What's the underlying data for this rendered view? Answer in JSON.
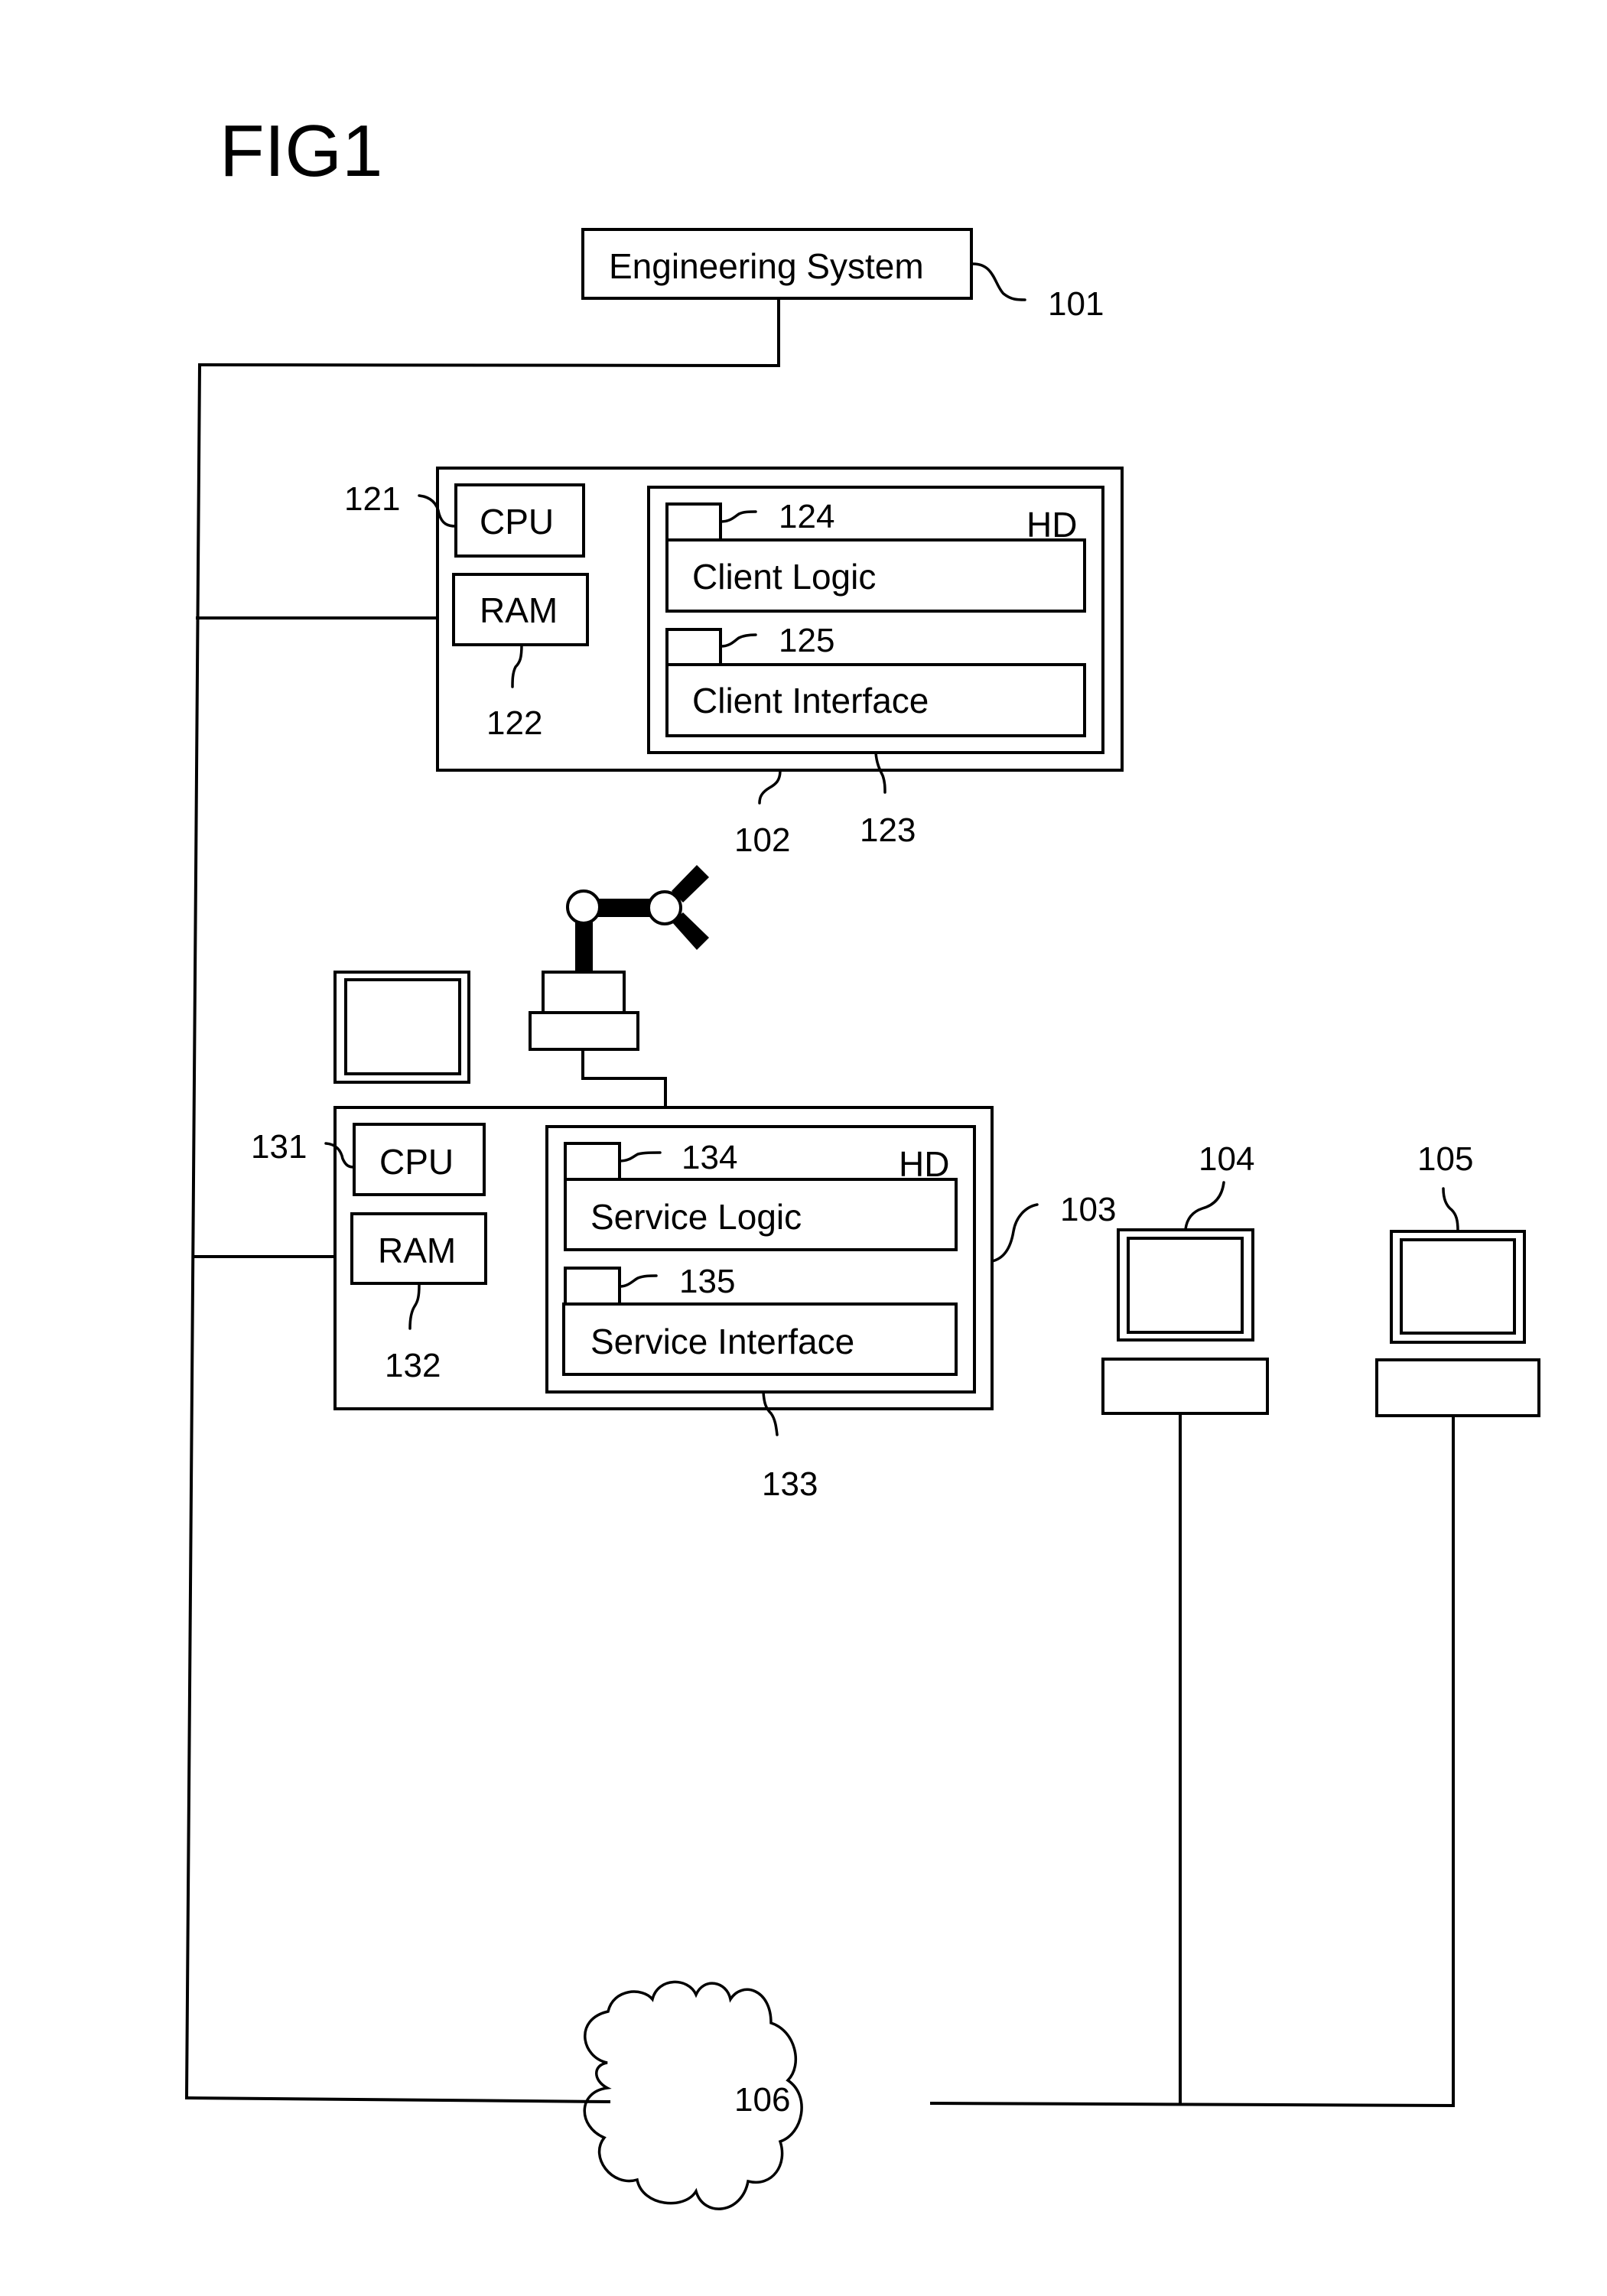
{
  "figure": {
    "title": "FIG1"
  },
  "engineering_system": {
    "label": "Engineering System",
    "ref": "101"
  },
  "client_computer": {
    "ref": "102",
    "cpu": {
      "label": "CPU",
      "ref": "121"
    },
    "ram": {
      "label": "RAM",
      "ref": "122"
    },
    "hard_disk": {
      "label": "HD",
      "ref": "123",
      "modules": [
        {
          "label": "Client Logic",
          "ref": "124"
        },
        {
          "label": "Client Interface",
          "ref": "125"
        }
      ]
    }
  },
  "service_computer": {
    "ref": "103",
    "cpu": {
      "label": "CPU",
      "ref": "131"
    },
    "ram": {
      "label": "RAM",
      "ref": "132"
    },
    "hard_disk": {
      "label": "HD",
      "ref": "133",
      "modules": [
        {
          "label": "Service Logic",
          "ref": "134"
        },
        {
          "label": "Service Interface",
          "ref": "135"
        }
      ]
    }
  },
  "workstations": [
    {
      "ref": "104"
    },
    {
      "ref": "105"
    }
  ],
  "network": {
    "ref": "106",
    "icon": "cloud-icon"
  },
  "devices": {
    "robot": "robot-arm-icon",
    "local_monitor": "monitor-icon"
  },
  "colors": {
    "stroke": "#000000",
    "background": "#ffffff"
  }
}
